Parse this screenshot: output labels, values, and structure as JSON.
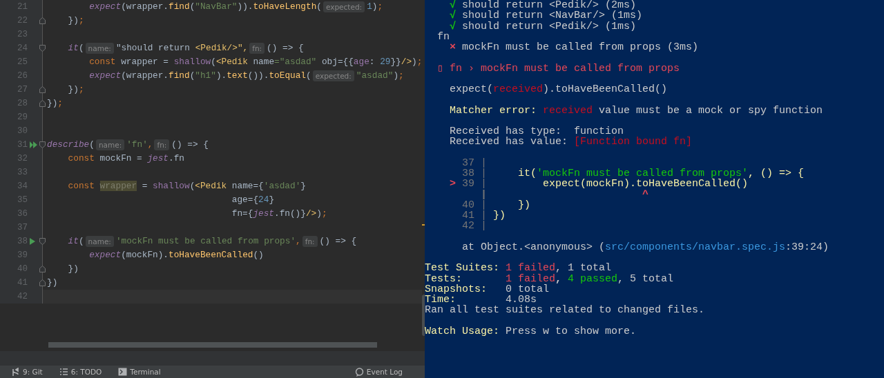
{
  "editor": {
    "lines": [
      {
        "number": "21",
        "segments": [
          {
            "kind": "code",
            "parts": [
              {
                "text": "        expect",
                "kind": "italic-fn"
              },
              {
                "text": "(wrapper.",
                "kind": "plain"
              },
              {
                "text": "find",
                "kind": "method"
              },
              {
                "text": "(",
                "kind": "plain"
              },
              {
                "text": "\"NavBar\"",
                "kind": "string"
              },
              {
                "text": ")).",
                "kind": "plain"
              },
              {
                "text": "toHaveLength",
                "kind": "method"
              },
              {
                "text": "(",
                "kind": "plain"
              }
            ]
          },
          {
            "kind": "hint",
            "text": "expected:"
          },
          {
            "kind": "code",
            "parts": [
              {
                "text": "1",
                "kind": "number"
              },
              {
                "text": ")",
                "kind": "plain"
              },
              {
                "text": ";",
                "kind": "punct"
              }
            ]
          }
        ]
      },
      {
        "number": "22",
        "fold_end": true,
        "segments": [
          {
            "kind": "code",
            "parts": [
              {
                "text": "    })",
                "kind": "plain"
              },
              {
                "text": ";",
                "kind": "punct"
              }
            ]
          }
        ]
      },
      {
        "number": "23"
      },
      {
        "number": "24",
        "fold_start": true,
        "segments": [
          {
            "kind": "code",
            "parts": [
              {
                "text": "    it",
                "kind": "italic-fn"
              },
              {
                "text": "(",
                "kind": "plain"
              }
            ]
          },
          {
            "kind": "hint",
            "text": "name:"
          },
          {
            "kind": "code",
            "parts": [
              {
                "text": "\"should return ",
                "kind": "plain"
              },
              {
                "text": "<Pedik/>\",",
                "kind": "tag"
              }
            ]
          },
          {
            "kind": "hint",
            "text": "fn:"
          },
          {
            "kind": "code",
            "parts": [
              {
                "text": "() => {",
                "kind": "plain"
              }
            ]
          }
        ]
      },
      {
        "number": "25",
        "segments": [
          {
            "kind": "code",
            "parts": [
              {
                "text": "        const",
                "kind": "keyword"
              },
              {
                "text": " wrapper = ",
                "kind": "plain"
              },
              {
                "text": "shallow",
                "kind": "purple"
              },
              {
                "text": "(",
                "kind": "plain"
              },
              {
                "text": "<Pedik",
                "kind": "tag"
              },
              {
                "text": " name",
                "kind": "plain"
              },
              {
                "text": "=\"asdad\"",
                "kind": "string"
              },
              {
                "text": " obj={{",
                "kind": "plain"
              },
              {
                "text": "age",
                "kind": "purple"
              },
              {
                "text": ": ",
                "kind": "plain"
              },
              {
                "text": "29",
                "kind": "number"
              },
              {
                "text": "}}",
                "kind": "plain"
              },
              {
                "text": "/>",
                "kind": "tag"
              },
              {
                "text": ")",
                "kind": "plain"
              },
              {
                "text": ";",
                "kind": "punct"
              }
            ]
          }
        ]
      },
      {
        "number": "26",
        "segments": [
          {
            "kind": "code",
            "parts": [
              {
                "text": "        expect",
                "kind": "italic-fn"
              },
              {
                "text": "(wrapper.",
                "kind": "plain"
              },
              {
                "text": "find",
                "kind": "method"
              },
              {
                "text": "(",
                "kind": "plain"
              },
              {
                "text": "\"h1\"",
                "kind": "string"
              },
              {
                "text": ").",
                "kind": "plain"
              },
              {
                "text": "text",
                "kind": "method"
              },
              {
                "text": "()).",
                "kind": "plain"
              },
              {
                "text": "toEqual",
                "kind": "method"
              },
              {
                "text": "(",
                "kind": "plain"
              }
            ]
          },
          {
            "kind": "hint",
            "text": "expected:"
          },
          {
            "kind": "code",
            "parts": [
              {
                "text": "\"asdad\"",
                "kind": "string"
              },
              {
                "text": ")",
                "kind": "plain"
              },
              {
                "text": ";",
                "kind": "punct"
              }
            ]
          }
        ]
      },
      {
        "number": "27",
        "fold_end": true,
        "segments": [
          {
            "kind": "code",
            "parts": [
              {
                "text": "    })",
                "kind": "plain"
              },
              {
                "text": ";",
                "kind": "punct"
              }
            ]
          }
        ]
      },
      {
        "number": "28",
        "fold_end": true,
        "segments": [
          {
            "kind": "code",
            "parts": [
              {
                "text": "})",
                "kind": "plain"
              },
              {
                "text": ";",
                "kind": "punct"
              }
            ]
          }
        ]
      },
      {
        "number": "29"
      },
      {
        "number": "30"
      },
      {
        "number": "31",
        "run_all": true,
        "fold_start": true,
        "segments": [
          {
            "kind": "code",
            "parts": [
              {
                "text": "describe",
                "kind": "italic-fn"
              },
              {
                "text": "(",
                "kind": "plain"
              }
            ]
          },
          {
            "kind": "hint",
            "text": "name:"
          },
          {
            "kind": "code",
            "parts": [
              {
                "text": "'fn'",
                "kind": "string"
              },
              {
                "text": ",",
                "kind": "punct"
              }
            ]
          },
          {
            "kind": "hint",
            "text": "fn:"
          },
          {
            "kind": "code",
            "parts": [
              {
                "text": "() => {",
                "kind": "plain"
              }
            ]
          }
        ]
      },
      {
        "number": "32",
        "segments": [
          {
            "kind": "code",
            "parts": [
              {
                "text": "    const",
                "kind": "keyword"
              },
              {
                "text": " mockFn = ",
                "kind": "plain"
              },
              {
                "text": "jest",
                "kind": "italic-fn"
              },
              {
                "text": ".fn",
                "kind": "plain"
              }
            ]
          }
        ]
      },
      {
        "number": "33"
      },
      {
        "number": "34",
        "segments": [
          {
            "kind": "code",
            "parts": [
              {
                "text": "    const ",
                "kind": "keyword"
              },
              {
                "text": "wrapper",
                "kind": "unused-highlight"
              },
              {
                "text": " = ",
                "kind": "plain"
              },
              {
                "text": "shallow",
                "kind": "purple"
              },
              {
                "text": "(",
                "kind": "plain"
              },
              {
                "text": "<Pedik",
                "kind": "tag"
              },
              {
                "text": " name={",
                "kind": "plain"
              },
              {
                "text": "'asdad'",
                "kind": "string"
              },
              {
                "text": "}",
                "kind": "plain"
              }
            ]
          }
        ]
      },
      {
        "number": "35",
        "segments": [
          {
            "kind": "code",
            "parts": [
              {
                "text": "                                   age={",
                "kind": "plain"
              },
              {
                "text": "24",
                "kind": "number"
              },
              {
                "text": "}",
                "kind": "plain"
              }
            ]
          }
        ]
      },
      {
        "number": "36",
        "segments": [
          {
            "kind": "code",
            "parts": [
              {
                "text": "                                   fn={",
                "kind": "plain"
              },
              {
                "text": "jest",
                "kind": "italic-fn"
              },
              {
                "text": ".fn()}",
                "kind": "plain"
              },
              {
                "text": "/>",
                "kind": "tag"
              },
              {
                "text": ")",
                "kind": "plain"
              },
              {
                "text": ";",
                "kind": "punct"
              }
            ]
          }
        ]
      },
      {
        "number": "37"
      },
      {
        "number": "38",
        "run": true,
        "fold_start": true,
        "segments": [
          {
            "kind": "code",
            "parts": [
              {
                "text": "    it",
                "kind": "italic-fn"
              },
              {
                "text": "(",
                "kind": "plain"
              }
            ]
          },
          {
            "kind": "hint",
            "text": "name:"
          },
          {
            "kind": "code",
            "parts": [
              {
                "text": "'mockFn must be called from props'",
                "kind": "string"
              },
              {
                "text": ",",
                "kind": "punct"
              }
            ]
          },
          {
            "kind": "hint",
            "text": "fn:"
          },
          {
            "kind": "code",
            "parts": [
              {
                "text": "() => {",
                "kind": "plain"
              }
            ]
          }
        ]
      },
      {
        "number": "39",
        "segments": [
          {
            "kind": "code",
            "parts": [
              {
                "text": "        expect",
                "kind": "italic-fn"
              },
              {
                "text": "(mockFn).",
                "kind": "plain"
              },
              {
                "text": "toHaveBeenCalled",
                "kind": "method"
              },
              {
                "text": "()",
                "kind": "plain"
              }
            ]
          }
        ]
      },
      {
        "number": "40",
        "fold_end": true,
        "segments": [
          {
            "kind": "code",
            "parts": [
              {
                "text": "    })",
                "kind": "plain"
              }
            ]
          }
        ]
      },
      {
        "number": "41",
        "fold_end": true,
        "segments": [
          {
            "kind": "code",
            "parts": [
              {
                "text": "})",
                "kind": "plain"
              }
            ]
          }
        ]
      },
      {
        "number": "42",
        "current": true
      }
    ]
  },
  "status_bar": {
    "items": [
      {
        "label": "9: Git"
      },
      {
        "label": "6: TODO"
      },
      {
        "label": "Terminal"
      }
    ],
    "right": {
      "label": "Event Log"
    }
  },
  "terminal": {
    "lines": [
      {
        "kind": "text",
        "spans": [
          {
            "text": "    √",
            "color": "#16c60c"
          },
          {
            "text": " should return <Pedik/> (2ms)",
            "color": "#cccccc"
          }
        ]
      },
      {
        "kind": "text",
        "spans": [
          {
            "text": "    √",
            "color": "#16c60c"
          },
          {
            "text": " should return <NavBar/> (1ms)",
            "color": "#cccccc"
          }
        ]
      },
      {
        "kind": "text",
        "spans": [
          {
            "text": "    √",
            "color": "#16c60c"
          },
          {
            "text": " should return <Pedik/> (1ms)",
            "color": "#cccccc"
          }
        ]
      },
      {
        "kind": "text",
        "spans": [
          {
            "text": "  fn",
            "color": "#cccccc"
          }
        ]
      },
      {
        "kind": "text",
        "spans": [
          {
            "text": "    ×",
            "color": "#e74856"
          },
          {
            "text": " mockFn must be called from props (3ms)",
            "color": "#cccccc"
          }
        ]
      },
      {
        "kind": "blank"
      },
      {
        "kind": "text",
        "spans": [
          {
            "text": "  ▯ fn › mockFn must be called from props",
            "color": "#e74856"
          }
        ]
      },
      {
        "kind": "blank"
      },
      {
        "kind": "text",
        "spans": [
          {
            "text": "    expect(",
            "color": "#cccccc"
          },
          {
            "text": "received",
            "color": "#c50f1f"
          },
          {
            "text": ").toHaveBeenCalled()",
            "color": "#cccccc"
          }
        ]
      },
      {
        "kind": "blank"
      },
      {
        "kind": "text",
        "spans": [
          {
            "text": "    Matcher error: ",
            "color": "#f9f1a5"
          },
          {
            "text": "received",
            "color": "#c50f1f"
          },
          {
            "text": " value must be a mock or spy function",
            "color": "#cccccc"
          }
        ]
      },
      {
        "kind": "blank"
      },
      {
        "kind": "text",
        "spans": [
          {
            "text": "    Received has type:  function",
            "color": "#cccccc"
          }
        ]
      },
      {
        "kind": "text",
        "spans": [
          {
            "text": "    Received has value: ",
            "color": "#cccccc"
          },
          {
            "text": "[Function bound fn]",
            "color": "#c50f1f"
          }
        ]
      },
      {
        "kind": "blank"
      },
      {
        "kind": "text",
        "spans": [
          {
            "text": "      37 |",
            "color": "#767676"
          }
        ]
      },
      {
        "kind": "text",
        "spans": [
          {
            "text": "      38 |",
            "color": "#767676"
          },
          {
            "text": "     it(",
            "color": "#f9f1a5"
          },
          {
            "text": "'mockFn must be called from props'",
            "color": "#16c60c"
          },
          {
            "text": ", () => {",
            "color": "#f9f1a5"
          }
        ]
      },
      {
        "kind": "text",
        "spans": [
          {
            "text": "    >",
            "color": "#e74856"
          },
          {
            "text": " 39 |",
            "color": "#767676"
          },
          {
            "text": "         expect(mockFn).toHaveBeenCalled()",
            "color": "#f9f1a5"
          }
        ]
      },
      {
        "kind": "text",
        "spans": [
          {
            "text": "         |                         ",
            "color": "#767676"
          },
          {
            "text": "^",
            "color": "#e74856"
          }
        ]
      },
      {
        "kind": "text",
        "spans": [
          {
            "text": "      40 |",
            "color": "#767676"
          },
          {
            "text": "     })",
            "color": "#f9f1a5"
          }
        ]
      },
      {
        "kind": "text",
        "spans": [
          {
            "text": "      41 |",
            "color": "#767676"
          },
          {
            "text": " })",
            "color": "#f9f1a5"
          }
        ]
      },
      {
        "kind": "text",
        "spans": [
          {
            "text": "      42 |",
            "color": "#767676"
          }
        ]
      },
      {
        "kind": "blank"
      },
      {
        "kind": "text",
        "spans": [
          {
            "text": "      at Object.<anonymous> (",
            "color": "#cccccc"
          },
          {
            "text": "src/components/navbar.spec.js",
            "color": "#3a96dd"
          },
          {
            "text": ":39:24)",
            "color": "#cccccc"
          }
        ]
      },
      {
        "kind": "blank"
      },
      {
        "kind": "text",
        "spans": [
          {
            "text": "Test Suites: ",
            "color": "#f9f1a5"
          },
          {
            "text": "1 failed",
            "color": "#e74856"
          },
          {
            "text": ", 1 total",
            "color": "#cccccc"
          }
        ]
      },
      {
        "kind": "text",
        "spans": [
          {
            "text": "Tests:       ",
            "color": "#f9f1a5"
          },
          {
            "text": "1 failed",
            "color": "#e74856"
          },
          {
            "text": ", ",
            "color": "#cccccc"
          },
          {
            "text": "4 passed",
            "color": "#16c60c"
          },
          {
            "text": ", 5 total",
            "color": "#cccccc"
          }
        ]
      },
      {
        "kind": "text",
        "spans": [
          {
            "text": "Snapshots:",
            "color": "#f9f1a5"
          },
          {
            "text": "   0 total",
            "color": "#cccccc"
          }
        ]
      },
      {
        "kind": "text",
        "spans": [
          {
            "text": "Time:",
            "color": "#f9f1a5"
          },
          {
            "text": "        4.08s",
            "color": "#cccccc"
          }
        ]
      },
      {
        "kind": "text",
        "spans": [
          {
            "text": "Ran all test suites related to changed files.",
            "color": "#cccccc"
          }
        ]
      },
      {
        "kind": "blank"
      },
      {
        "kind": "text",
        "spans": [
          {
            "text": "Watch Usage:",
            "color": "#f9f1a5"
          },
          {
            "text": " Press w to show more.",
            "color": "#cccccc"
          }
        ]
      }
    ]
  }
}
